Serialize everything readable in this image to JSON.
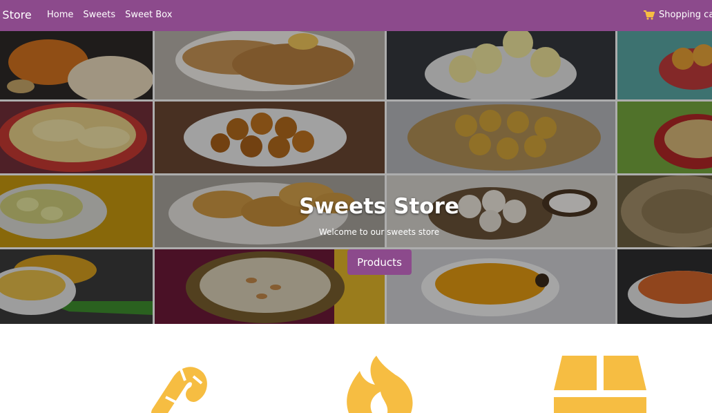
{
  "navbar": {
    "brand": "s Store",
    "links": [
      "Home",
      "Sweets",
      "Sweet Box"
    ],
    "cart_label": "Shopping ca",
    "cart_icon": "shopping-cart-icon"
  },
  "hero": {
    "title": "Sweets Store",
    "subtitle": "Welcome to our sweets store",
    "button_label": "Products",
    "background": "sweets-photo-collage"
  },
  "features": {
    "icons": [
      "candy-cane-icon",
      "fire-icon",
      "box-icon"
    ],
    "icon_color": "#f6bd42"
  },
  "colors": {
    "brand": "#8c4a8c",
    "accent": "#f6bd42"
  }
}
